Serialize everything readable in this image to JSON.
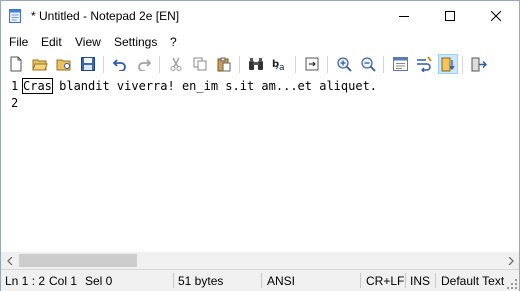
{
  "window": {
    "title": "* Untitled - Notepad 2e [EN]"
  },
  "title_buttons": {
    "minimize": "minimize-icon",
    "maximize": "maximize-icon",
    "close": "close-icon"
  },
  "menu": {
    "items": [
      "File",
      "Edit",
      "View",
      "Settings",
      "?"
    ]
  },
  "toolbar": {
    "icons": [
      "new",
      "open",
      "browse",
      "save",
      "undo",
      "redo",
      "cut",
      "copy",
      "paste",
      "find",
      "replace",
      "goto",
      "zoom-in",
      "zoom-out",
      "view-options",
      "wordwrap",
      "scheme",
      "exit"
    ]
  },
  "editor": {
    "line_numbers": [
      "1",
      "2"
    ],
    "lines": [
      {
        "highlight": "Cras",
        "rest": " blandit viverra! en_im s.it am...et aliquet."
      },
      {
        "highlight": "",
        "rest": ""
      }
    ]
  },
  "status": {
    "position": "Ln 1 : 2",
    "column": "Col 1",
    "selection": "Sel 0",
    "size": "51 bytes",
    "encoding": "ANSI",
    "line_ending": "CR+LF",
    "mode": "INS",
    "scheme": "Default Text"
  },
  "colors": {
    "accent": "#3f82d0",
    "active_button": "#cce8ff"
  }
}
